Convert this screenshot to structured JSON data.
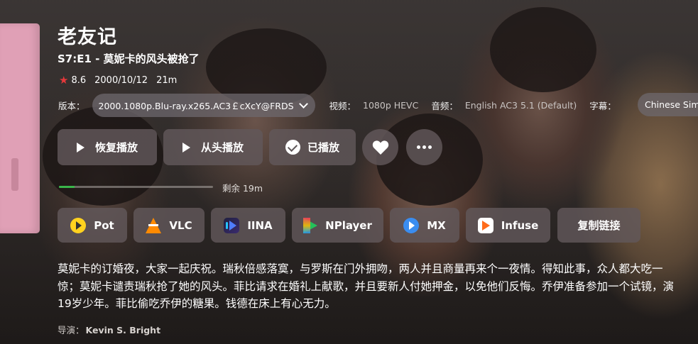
{
  "show": {
    "title": "老友记",
    "episode": "S7:E1 - 莫妮卡的风头被抢了",
    "rating": "8.6",
    "date": "2000/10/12",
    "duration": "21m"
  },
  "media_info": {
    "version_label": "版本：",
    "version_value": "2000.1080p.Blu-ray.x265.AC3￡cXcY@FRDS",
    "video_label": "视频：",
    "video_value": "1080p HEVC",
    "audio_label": "音频：",
    "audio_value": "English AC3 5.1 (Default)",
    "subtitle_label": "字幕：",
    "subtitle_value": "Chinese Simplified"
  },
  "actions": {
    "resume": "恢复播放",
    "restart": "从头播放",
    "played": "已播放"
  },
  "progress": {
    "fraction": 0.1,
    "remaining": "剩余 19m"
  },
  "players": [
    "Pot",
    "VLC",
    "IINA",
    "NPlayer",
    "MX",
    "Infuse"
  ],
  "copy_link": "复制链接",
  "description": "莫妮卡的订婚夜，大家一起庆祝。瑞秋倍感落寞，与罗斯在门外拥吻，两人并且商量再来个一夜情。得知此事，众人都大吃一惊；莫妮卡谴责瑞秋抢了她的风头。菲比请求在婚礼上献歌，并且要新人付她押金，以免他们反悔。乔伊准备参加一个试镜，演19岁少年。菲比偷吃乔伊的糖果。钱德在床上有心无力。",
  "director_label": "导演：",
  "director_name": "Kevin S. Bright",
  "colors": {
    "accent_green": "#3ab54a",
    "star_red": "#e5383b",
    "button_bg": "#625a5c"
  }
}
